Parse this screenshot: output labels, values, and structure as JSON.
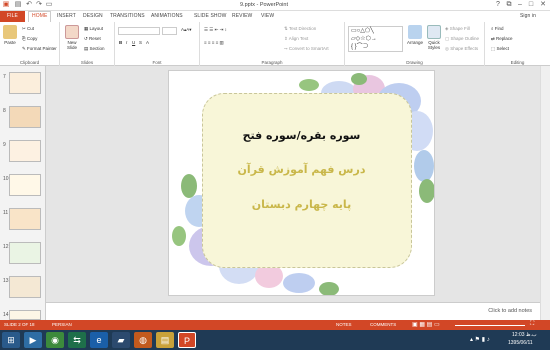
{
  "window": {
    "title": "9.pptx - PowerPoint",
    "sign_in": "Sign in"
  },
  "tabs": [
    "FILE",
    "HOME",
    "INSERT",
    "DESIGN",
    "TRANSITIONS",
    "ANIMATIONS",
    "SLIDE SHOW",
    "REVIEW",
    "VIEW"
  ],
  "ribbon": {
    "clipboard": {
      "paste": "Paste",
      "cut": "Cut",
      "copy": "Copy",
      "format_painter": "Format Painter",
      "label": "Clipboard"
    },
    "slides": {
      "new_slide": "New Slide",
      "layout": "Layout",
      "reset": "Reset",
      "section": "Section",
      "label": "Slides"
    },
    "font": {
      "label": "Font"
    },
    "paragraph": {
      "text_direction": "Text Direction",
      "align_text": "Align Text",
      "convert_smartart": "Convert to SmartArt",
      "label": "Paragraph"
    },
    "drawing": {
      "arrange": "Arrange",
      "quick_styles": "Quick Styles",
      "shape_fill": "Shape Fill",
      "shape_outline": "Shape Outline",
      "shape_effects": "Shape Effects",
      "label": "Drawing"
    },
    "editing": {
      "find": "Find",
      "replace": "Replace",
      "select": "Select",
      "label": "Editing"
    }
  },
  "thumbnails": [
    "7",
    "8",
    "9",
    "10",
    "11",
    "12",
    "13",
    "14"
  ],
  "slide": {
    "line1": "سوره بقره/سوره فتح",
    "line2": "درس فهم آموزش قرآن",
    "line3": "پایه چهارم دبستان"
  },
  "notes_placeholder": "Click to add notes",
  "status": {
    "slide": "SLIDE 2 OF 18",
    "language": "PERSIAN",
    "notes": "NOTES",
    "comments": "COMMENTS"
  },
  "taskbar": {
    "time": "12:03 ب.ظ",
    "date": "1395/06/11"
  },
  "colors": {
    "accent": "#d24726",
    "taskbar": "#1f3a55",
    "panel": "#f8f6d8",
    "title_text": "#111111",
    "sub_text": "#c9b74a"
  }
}
